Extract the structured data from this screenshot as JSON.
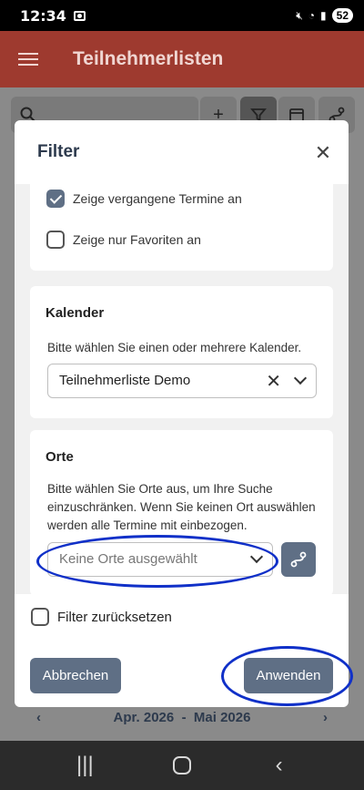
{
  "status_bar": {
    "time": "12:34",
    "battery": "52"
  },
  "app_bar": {
    "title": "Teilnehmerlisten"
  },
  "dialog": {
    "title": "Filter",
    "options": [
      {
        "label": "Zeige vergangene Termine an",
        "checked": true
      },
      {
        "label": "Zeige nur Favoriten an",
        "checked": false
      }
    ],
    "calendar": {
      "title": "Kalender",
      "description": "Bitte wählen Sie einen oder mehrere Kalender.",
      "selected": "Teilnehmerliste Demo"
    },
    "places": {
      "title": "Orte",
      "description": "Bitte wählen Sie Orte aus, um Ihre Suche einzuschränken. Wenn Sie keinen Ort auswählen werden alle Termine mit einbezogen.",
      "placeholder": "Keine Orte ausgewählt"
    },
    "reset_label": "Filter zurücksetzen",
    "cancel_label": "Abbrechen",
    "apply_label": "Anwenden"
  },
  "date_range": {
    "from": "Apr. 2026",
    "separator": "-",
    "to": "Mai 2026"
  },
  "icons": {
    "menu": "hamburger-icon",
    "search": "search-icon",
    "add": "plus-icon",
    "filter": "filter-icon",
    "calendar": "calendar-icon",
    "route": "route-icon",
    "close": "close-icon"
  },
  "colors": {
    "app_bar": "#9e3a2f",
    "button": "#5f6f85",
    "annotation": "#1030c8"
  }
}
